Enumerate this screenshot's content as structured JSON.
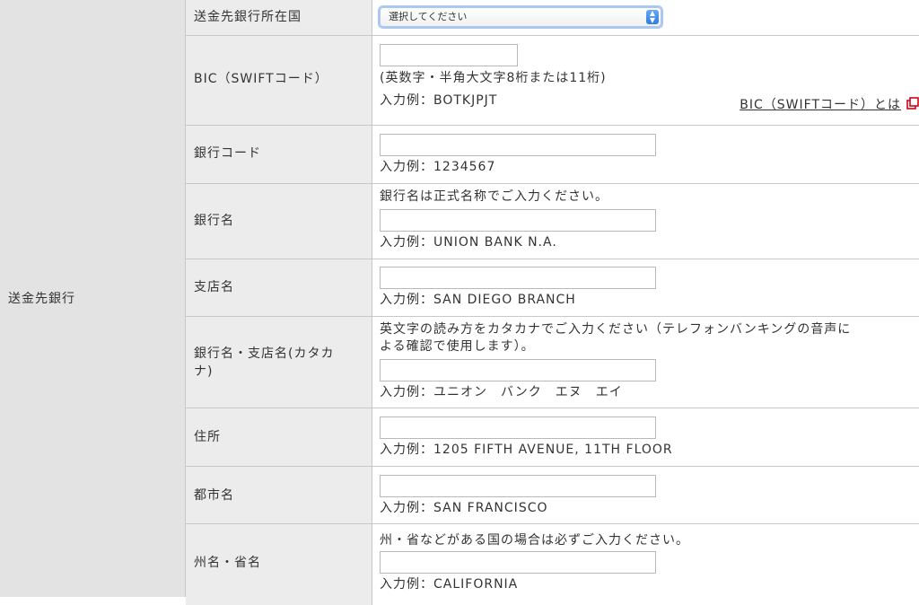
{
  "outer": {
    "label": "送金先銀行"
  },
  "rows": {
    "country": {
      "label": "送金先銀行所在国",
      "select_value": "選択してください"
    },
    "bic": {
      "label": "BIC（SWIFTコード）",
      "hint": "(英数字・半角大文字8桁または11桁)",
      "example": "入力例：BOTKJPJT",
      "link": "BIC（SWIFTコード）とは",
      "value": ""
    },
    "bank_code": {
      "label": "銀行コード",
      "example": "入力例：1234567",
      "value": ""
    },
    "bank_name": {
      "label": "銀行名",
      "note": "銀行名は正式名称でご入力ください。",
      "example": "入力例：UNION BANK N.A.",
      "value": ""
    },
    "branch": {
      "label": "支店名",
      "example": "入力例：SAN DIEGO BRANCH",
      "value": ""
    },
    "kana": {
      "label_line1": "銀行名・支店名(カタカ",
      "label_line2": "ナ)",
      "note_line1": "英文字の読み方をカタカナでご入力ください（テレフォンバンキングの音声に",
      "note_line2": "よる確認で使用します）。",
      "example": "入力例：ユニオン　バンク　エヌ　エイ",
      "value": ""
    },
    "address": {
      "label": "住所",
      "example": "入力例：1205 FIFTH AVENUE, 11TH FLOOR",
      "value": ""
    },
    "city": {
      "label": "都市名",
      "example": "入力例：SAN FRANCISCO",
      "value": ""
    },
    "state": {
      "label": "州名・省名",
      "note": "州・省などがある国の場合は必ずご入力ください。",
      "example": "入力例：CALIFORNIA",
      "value": ""
    }
  },
  "colors": {
    "accent": "#2d7de4",
    "external_icon": "#d0021b"
  }
}
